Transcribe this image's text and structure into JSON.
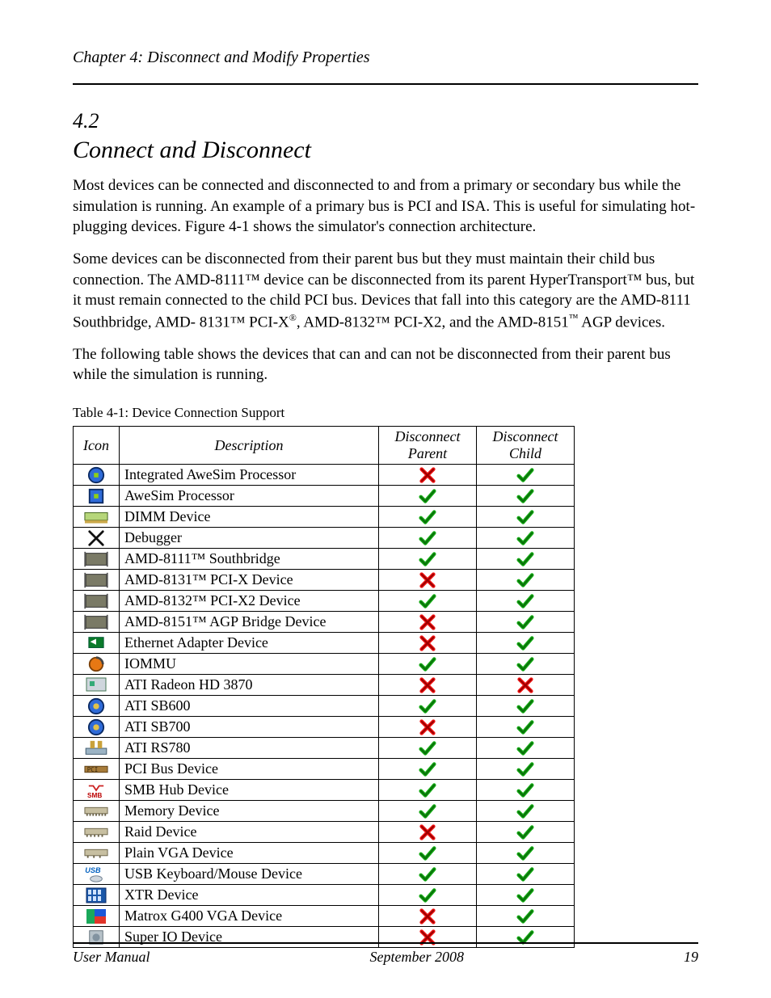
{
  "running_head": "Chapter 4: Disconnect and Modify Properties",
  "section_number": "4.2",
  "section_title": "Connect and Disconnect",
  "para1_a": "Most devices can be connected and disconnected to and from a primary or secondary bus while the simulation is running. An example of a primary bus is PCI and ISA. This is useful for simulating hot-plugging devices. Figure 4-1 shows ",
  "para1_b": "the simulator's",
  "para1_c": " connection architecture.",
  "para2_a": "Some devices can be disconnected from their parent bus but they must maintain their child bus connection. The AMD-8111™ device can be disconnected from its parent HyperTransport™ bus, but it must remain connected to the child PCI bus. Devices that fall into this category are the AMD-8111 Southbridge, AMD-",
  "para2_b": "8131™",
  "para2_c": " PCI-X",
  "para2_sup": "®",
  "para2_d": ", AMD-8132™ PCI-X2, and the AMD-8151",
  "para2_tm": "™",
  "para2_e": " AGP devices.",
  "para3": "The following table shows the devices that can and can not be disconnected from their parent bus while the simulation is running.",
  "caption": "Table 4-1: Device Connection Support",
  "headers": [
    "Icon",
    "Description",
    "Disconnect Parent",
    "Disconnect Child"
  ],
  "rows": [
    {
      "icon": "cpu-blue-circle",
      "name": "Integrated AweSim Processor",
      "p": "x",
      "c": "v"
    },
    {
      "icon": "cpu-green-square",
      "name": "AweSim Processor",
      "p": "v",
      "c": "v"
    },
    {
      "icon": "dimm-icon",
      "name": "DIMM Device",
      "p": "v",
      "c": "v"
    },
    {
      "icon": "debugger-icon",
      "name": "Debugger",
      "p": "v",
      "c": "v"
    },
    {
      "icon": "amd-8111-icon",
      "name": "AMD-8111™ Southbridge",
      "p": "v",
      "c": "v"
    },
    {
      "icon": "amd-8131-icon",
      "name": "AMD-8131™ PCI-X Device",
      "p": "x",
      "c": "v"
    },
    {
      "icon": "amd-8132-icon",
      "name": "AMD-8132™ PCI-X2 Device",
      "p": "v",
      "c": "v"
    },
    {
      "icon": "amd-8151-icon",
      "name": "AMD-8151™ AGP Bridge Device",
      "p": "x",
      "c": "v"
    },
    {
      "icon": "ethernet-icon",
      "name": "Ethernet Adapter Device",
      "p": "x",
      "c": "v"
    },
    {
      "icon": "iommu-icon",
      "name": "IOMMU",
      "p": "v",
      "c": "v"
    },
    {
      "icon": "ati-radeon-icon",
      "name": "ATI Radeon HD 3870",
      "p": "x",
      "c": "x"
    },
    {
      "icon": "ati-sb600-icon",
      "name": "ATI SB600",
      "p": "v",
      "c": "v"
    },
    {
      "icon": "ati-sb700-icon",
      "name": "ATI SB700",
      "p": "x",
      "c": "v"
    },
    {
      "icon": "ati-rs780-icon",
      "name": "ATI RS780",
      "p": "v",
      "c": "v"
    },
    {
      "icon": "pci-bus-icon",
      "name": "PCI Bus Device",
      "p": "v",
      "c": "v"
    },
    {
      "icon": "smb-icon",
      "name": "SMB Hub Device",
      "p": "v",
      "c": "v"
    },
    {
      "icon": "memory-device-icon",
      "name": "Memory Device",
      "p": "v",
      "c": "v"
    },
    {
      "icon": "raid-icon",
      "name": "Raid Device",
      "p": "x",
      "c": "v"
    },
    {
      "icon": "plain-vga-icon",
      "name": "Plain VGA Device",
      "p": "v",
      "c": "v"
    },
    {
      "icon": "usb-icon",
      "name": "USB Keyboard/Mouse Device",
      "p": "v",
      "c": "v"
    },
    {
      "icon": "xtr-icon",
      "name": "XTR Device",
      "p": "v",
      "c": "v"
    },
    {
      "icon": "vga-emerald-icon",
      "name": "Matrox G400 VGA Device",
      "p": "x",
      "c": "v"
    },
    {
      "icon": "super-io-icon",
      "name": "Super IO Device",
      "p": "x",
      "c": "v"
    }
  ],
  "footer_left": "User Manual",
  "footer_center": "September 2008",
  "footer_right": "19"
}
